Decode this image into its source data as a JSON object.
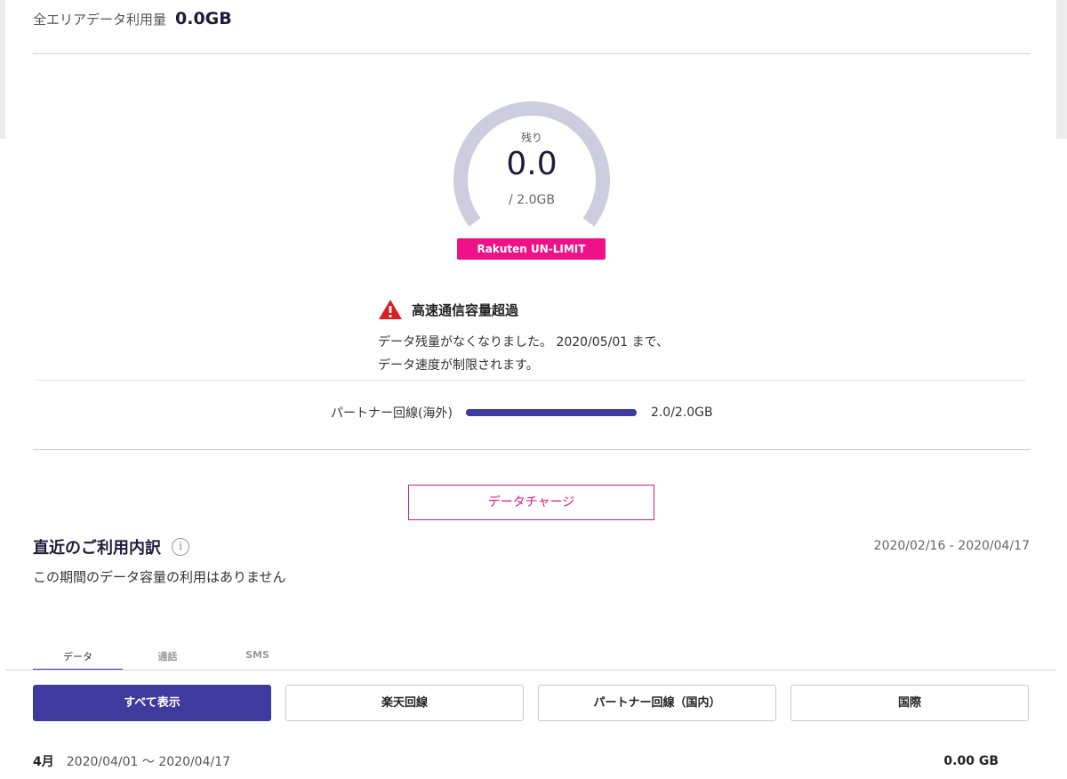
{
  "summary": {
    "total_label": "全エリアデータ利用量",
    "total_value": "0.0GB"
  },
  "gauge": {
    "caption": "残り",
    "remaining": "0.0",
    "total": "/ 2.0GB",
    "fraction_remaining": 0.0
  },
  "plan_badge": "Rakuten UN-LIMIT",
  "warning": {
    "icon": "warning-triangle-icon",
    "title": "高速通信容量超過",
    "message": "データ残量がなくなりました。 2020/05/01 まで、データ速度が制限されます。"
  },
  "partner": {
    "label": "パートナー回線(海外)",
    "value": "2.0/2.0GB",
    "fraction_used": 1.0
  },
  "charge_button": "データチャージ",
  "recent": {
    "title": "直近のご利用内訳",
    "info_icon": "info-icon",
    "period": "2020/02/16 - 2020/04/17",
    "no_usage": "この期間のデータ容量の利用はありません"
  },
  "tabs": [
    {
      "label": "データ",
      "active": true
    },
    {
      "label": "通話",
      "active": false
    },
    {
      "label": "SMS",
      "active": false
    }
  ],
  "filters": [
    {
      "label": "すべて表示",
      "active": true
    },
    {
      "label": "楽天回線",
      "active": false
    },
    {
      "label": "パートナー回線（国内）",
      "active": false
    },
    {
      "label": "国際",
      "active": false
    }
  ],
  "month": {
    "label": "4月",
    "range": "2020/04/01 〜 2020/04/17",
    "total": "0.00 GB"
  },
  "colors": {
    "accent": "#3f3a9e",
    "brand_pink": "#ee1188",
    "gauge_track": "#cdcddf",
    "warning_red": "#d92020"
  }
}
